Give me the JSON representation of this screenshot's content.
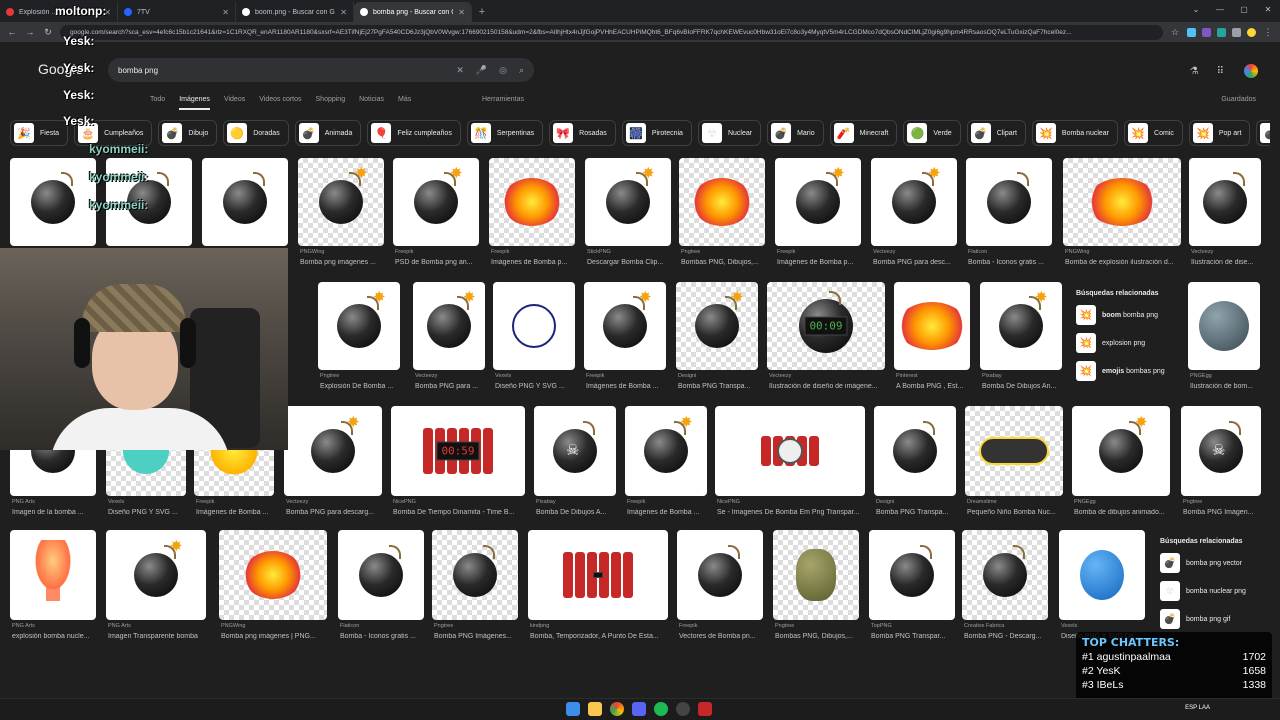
{
  "browser": {
    "tabs": [
      {
        "label": "Explosión …",
        "favicon_color": "#e53935"
      },
      {
        "label": "7TV",
        "favicon_color": "#2962ff"
      },
      {
        "label": "boom.png - Buscar con Google",
        "favicon_color": "#ffffff"
      },
      {
        "label": "bomba png - Buscar con Google",
        "favicon_color": "#ffffff"
      }
    ],
    "new_tab": "+",
    "url": "google.com/search?sca_esv=4efc6c15b1c21641&rlz=1C1RXQR_enAR1180AR1180&sxsrf=AE3TifNjEj27PgFA540CD6Jz3jQbV0Wvgw:1766902150158&udm=2&fbs=AIlhjHtx4nJjfGojPVHhEACUHPiMQht6_BFq6vBIoFFRK7qchKEWEvuc0Hbw31oEl7c8o3y4MyqtV5m4rLCGDMco7dQbsONdClMLjZ0gi6g9hpm4RRsaosOQ7eLTuGxizQaF7hcel0ez..."
  },
  "google": {
    "logo": "Google",
    "query": "bomba png",
    "tabs": [
      "Todo",
      "Imágenes",
      "Videos",
      "Videos cortos",
      "Shopping",
      "Noticias",
      "Más"
    ],
    "active_tab": "Imágenes",
    "tools_label": "Herramientas",
    "saved_label": "Guardados"
  },
  "chips": [
    {
      "label": "Fiesta",
      "icon": "🎉"
    },
    {
      "label": "Cumpleaños",
      "icon": "🎂"
    },
    {
      "label": "Dibujo",
      "icon": "💣"
    },
    {
      "label": "Doradas",
      "icon": "🟡"
    },
    {
      "label": "Animada",
      "icon": "💣"
    },
    {
      "label": "Feliz cumpleaños",
      "icon": "🎈"
    },
    {
      "label": "Serpentinas",
      "icon": "🎊"
    },
    {
      "label": "Rosadas",
      "icon": "🎀"
    },
    {
      "label": "Pirotecnia",
      "icon": "🎆"
    },
    {
      "label": "Nuclear",
      "icon": "☢"
    },
    {
      "label": "Mario",
      "icon": "💣"
    },
    {
      "label": "Minecraft",
      "icon": "🧨"
    },
    {
      "label": "Verde",
      "icon": "🟢"
    },
    {
      "label": "Clipart",
      "icon": "💣"
    },
    {
      "label": "Bomba nuclear",
      "icon": "💥"
    },
    {
      "label": "Comic",
      "icon": "💥"
    },
    {
      "label": "Pop art",
      "icon": "💥"
    },
    {
      "label": "Pn",
      "icon": "💣"
    }
  ],
  "row1": [
    {
      "src": "",
      "title": "",
      "kind": "bomb"
    },
    {
      "src": "",
      "title": "",
      "kind": "bomb"
    },
    {
      "src": "",
      "title": "",
      "kind": "bomb"
    },
    {
      "src": "PNGWing",
      "title": "Bomba png imágenes ...",
      "kind": "bomb-spark"
    },
    {
      "src": "Freepik",
      "title": "PSD de Bomba png an...",
      "kind": "bomb-spark"
    },
    {
      "src": "Freepik",
      "title": "Imágenes de Bomba p...",
      "kind": "explo"
    },
    {
      "src": "StickPNG",
      "title": "Descargar Bomba Clip...",
      "kind": "bomb-spark"
    },
    {
      "src": "Pngtree",
      "title": "Bombas PNG, Dibujos,...",
      "kind": "explo"
    },
    {
      "src": "Freepik",
      "title": "Imágenes de Bomba p...",
      "kind": "bomb-spark"
    },
    {
      "src": "Vecteezy",
      "title": "Bomba PNG para desc...",
      "kind": "bomb-spark"
    },
    {
      "src": "Flaticon",
      "title": "Bomba - Iconos gratis ...",
      "kind": "bomb"
    },
    {
      "src": "PNGWing",
      "title": "Bomba de explosión ilustración d...",
      "kind": "boom"
    },
    {
      "src": "Vecteezy",
      "title": "Ilustración de dise...",
      "kind": "bomb"
    }
  ],
  "row2": [
    {
      "src": "Pngtree",
      "title": "Explosión De Bomba ...",
      "kind": "bomb-spark"
    },
    {
      "src": "Vecteezy",
      "title": "Bomba PNG para ...",
      "kind": "bomb-spark"
    },
    {
      "src": "Vexels",
      "title": "Diseño PNG Y SVG ...",
      "kind": "outline"
    },
    {
      "src": "Freepik",
      "title": "Imágenes de Bomba ...",
      "kind": "bomb-spark"
    },
    {
      "src": "Designi",
      "title": "Bomba PNG Transpa...",
      "kind": "bomb-spark"
    },
    {
      "src": "Vecteezy",
      "title": "Ilustración de diseño de imágene...",
      "kind": "timer",
      "timer": "00:09"
    },
    {
      "src": "Pinterest",
      "title": "A Bomba PNG , Est...",
      "kind": "boom"
    },
    {
      "src": "Pixabay",
      "title": "Bomba De Dibujos An...",
      "kind": "bomb-spark"
    },
    {
      "src": "PNGEgg",
      "title": "Ilustración de bom...",
      "kind": "angry"
    }
  ],
  "related1": {
    "heading": "Búsquedas relacionadas",
    "items": [
      {
        "bold": "boom",
        "rest": " bomba png",
        "icon": "💥"
      },
      {
        "bold": "",
        "rest": "explosion png",
        "icon": "💥"
      },
      {
        "bold": "emojis",
        "rest": " bombas png",
        "icon": "💥"
      }
    ]
  },
  "row3": [
    {
      "src": "PNG Arts",
      "title": "Imagen de la bomba ...",
      "kind": "bomb"
    },
    {
      "src": "Vexels",
      "title": "Diseño PNG Y SVG ...",
      "kind": "smile"
    },
    {
      "src": "Freepik",
      "title": "Imágenes de Bomba ...",
      "kind": "pow"
    },
    {
      "src": "Vecteezy",
      "title": "Bomba PNG para descarg...",
      "kind": "bomb-spark"
    },
    {
      "src": "NicePNG",
      "title": "Bomba De Tiempo Dinamita - Time B...",
      "kind": "dynamite",
      "timer": "00:59"
    },
    {
      "src": "Pixabay",
      "title": "Bomba De Dibujos A...",
      "kind": "skull"
    },
    {
      "src": "Freepik",
      "title": "Imágenes de Bomba ...",
      "kind": "bomb-spark"
    },
    {
      "src": "NicePNG",
      "title": "Se - Imagenes De Bomba Em Png Transpar...",
      "kind": "clock"
    },
    {
      "src": "Designi",
      "title": "Bomba PNG Transpa...",
      "kind": "bomb"
    },
    {
      "src": "Dreamstime",
      "title": "Pequeño Niño Bomba Nuc...",
      "kind": "nuke"
    },
    {
      "src": "PNGEgg",
      "title": "Bomba de dibujos animado...",
      "kind": "bomb-spark"
    },
    {
      "src": "Pngtree",
      "title": "Bomba PNG Imágen...",
      "kind": "skull"
    }
  ],
  "row4": [
    {
      "src": "PNG Arts",
      "title": "explosión bomba nucle...",
      "kind": "mushroom"
    },
    {
      "src": "PNG Arts",
      "title": "Imagen Transparente bomba",
      "kind": "bomb-spark"
    },
    {
      "src": "PNGWing",
      "title": "Bomba png imágenes | PNG...",
      "kind": "explo"
    },
    {
      "src": "Flaticon",
      "title": "Bomba - Iconos gratis ...",
      "kind": "bomb"
    },
    {
      "src": "Pngtree",
      "title": "Bomba PNG Imágenes...",
      "kind": "bomb"
    },
    {
      "src": "kindpng",
      "title": "Bomba, Temporizador, A Punto De Esta...",
      "kind": "dynamite",
      "timer": ""
    },
    {
      "src": "Freepik",
      "title": "Vectores de Bomba pn...",
      "kind": "bomb"
    },
    {
      "src": "Pngtree",
      "title": "Bombas PNG, Dibujos,...",
      "kind": "grenade"
    },
    {
      "src": "TopPNG",
      "title": "Bomba PNG Transpar...",
      "kind": "bomb"
    },
    {
      "src": "Creative Fabrica",
      "title": "Bomba PNG - Descarg...",
      "kind": "face"
    },
    {
      "src": "Vexels",
      "title": "Diseño PNG Y SVG De ...",
      "kind": "blue"
    }
  ],
  "related2": {
    "heading": "Búsquedas relacionadas",
    "items": [
      {
        "bold": "",
        "rest": "bomba png vector",
        "icon": "💣"
      },
      {
        "bold": "",
        "rest": "bomba nuclear png",
        "icon": "☢"
      },
      {
        "bold": "",
        "rest": "bomba png gif",
        "icon": "💣"
      }
    ]
  },
  "chat_overlay": [
    {
      "text": "moltonp:",
      "class": "w"
    },
    {
      "text": "Yesk:",
      "class": "w"
    },
    {
      "text": "Yesk:",
      "class": "w"
    },
    {
      "text": "Yesk:",
      "class": "w"
    },
    {
      "text": "Yesk:",
      "class": "w"
    },
    {
      "text": "kyommeii:",
      "class": "g"
    },
    {
      "text": "kyommeii:",
      "class": "g"
    },
    {
      "text": "kyommeii:",
      "class": "g"
    }
  ],
  "top_chatters": {
    "heading": "TOP CHATTERS:",
    "rows": [
      {
        "rank": "#1",
        "name": "agustinpaalmaa",
        "count": "1702"
      },
      {
        "rank": "#2",
        "name": "YesK",
        "count": "1658"
      },
      {
        "rank": "#3",
        "name": "IBeLs",
        "count": "1338"
      }
    ]
  },
  "taskbar": {
    "tray": "ESP LAA",
    "time": "",
    "date": ""
  }
}
